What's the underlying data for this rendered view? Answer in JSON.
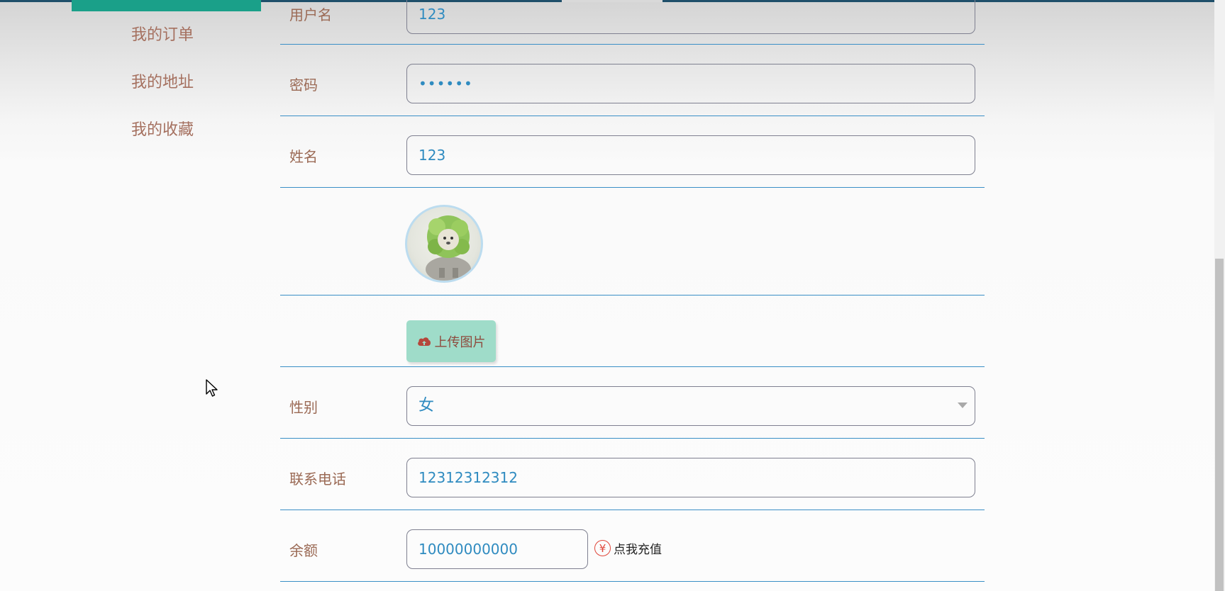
{
  "sidebar": {
    "items": [
      {
        "label": "我的订单"
      },
      {
        "label": "我的地址"
      },
      {
        "label": "我的收藏"
      }
    ]
  },
  "form": {
    "username": {
      "label": "用户名",
      "value": "123"
    },
    "password": {
      "label": "密码",
      "value": "123456"
    },
    "name": {
      "label": "姓名",
      "value": "123"
    },
    "avatar": {
      "icon": "avatar-image"
    },
    "upload": {
      "label": "上传图片",
      "icon": "cloud-upload-icon"
    },
    "gender": {
      "label": "性别",
      "value": "女"
    },
    "phone": {
      "label": "联系电话",
      "value": "12312312312"
    },
    "balance": {
      "label": "余额",
      "value": "10000000000",
      "recharge_label": "点我充值",
      "recharge_icon": "yen-icon",
      "currency_symbol": "¥"
    }
  },
  "colors": {
    "accent_green": "#1aa089",
    "upload_button": "#9fdcc9",
    "row_divider": "#3a8fc6",
    "label_text": "#9b6a55",
    "value_text": "#2f8bc0",
    "recharge_icon": "#e0463a"
  }
}
